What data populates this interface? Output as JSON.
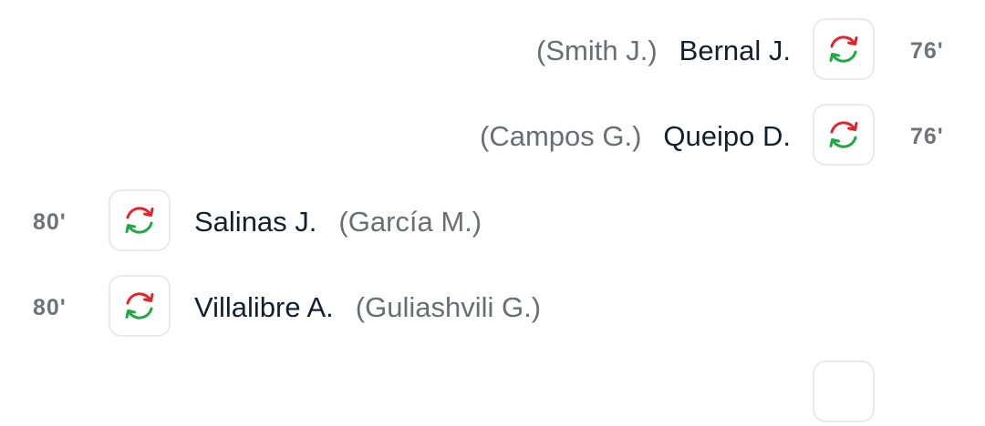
{
  "substitutions": [
    {
      "side": "away",
      "minute": "76'",
      "player_in": "Bernal J.",
      "player_out": "(Smith J.)"
    },
    {
      "side": "away",
      "minute": "76'",
      "player_in": "Queipo D.",
      "player_out": "(Campos G.)"
    },
    {
      "side": "home",
      "minute": "80'",
      "player_in": "Salinas J.",
      "player_out": "(García M.)"
    },
    {
      "side": "home",
      "minute": "80'",
      "player_in": "Villalibre A.",
      "player_out": "(Guliashvili G.)"
    }
  ],
  "icons": {
    "substitution": "substitution-icon"
  },
  "colors": {
    "arrow_out": "#e0252d",
    "arrow_in": "#20a844",
    "player_in_text": "#12202e",
    "player_out_text": "#696e73",
    "minute_text": "#6e7378"
  }
}
